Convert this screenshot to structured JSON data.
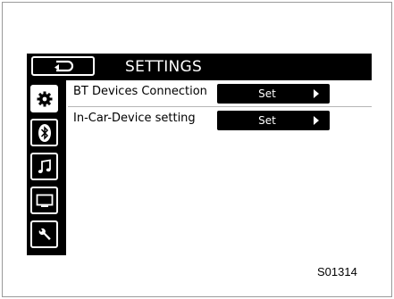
{
  "header": {
    "title": "SETTINGS",
    "back_icon": "back-return-icon"
  },
  "sidebar": {
    "items": [
      {
        "icon": "gear-icon",
        "active": true
      },
      {
        "icon": "bluetooth-icon",
        "active": false
      },
      {
        "icon": "music-note-icon",
        "active": false
      },
      {
        "icon": "screen-icon",
        "active": false
      },
      {
        "icon": "wrench-icon",
        "active": false
      }
    ]
  },
  "settings": {
    "rows": [
      {
        "label": "BT Devices Connection",
        "button": "Set"
      },
      {
        "label": "In-Car-Device setting",
        "button": "Set"
      }
    ]
  },
  "figure_code": "S01314"
}
